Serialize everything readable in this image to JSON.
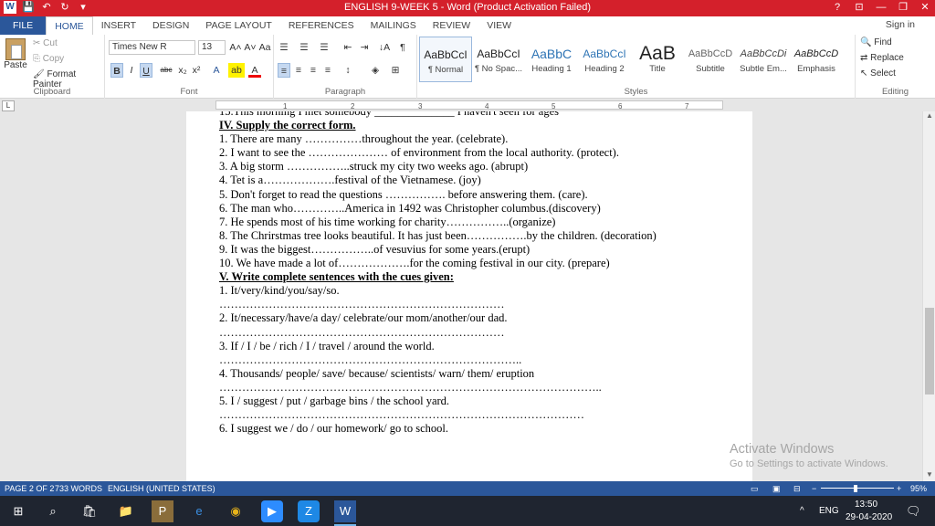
{
  "titlebar": {
    "title": "ENGLISH 9-WEEK 5 -  Word (Product Activation Failed)",
    "help": "?",
    "ribbon_options": "⊡",
    "minimize": "—",
    "restore": "❐",
    "close": "✕"
  },
  "qat": {
    "logo": "W",
    "save": "💾",
    "undo": "↶",
    "redo": "↻",
    "customize": "▾"
  },
  "tabs": [
    "FILE",
    "HOME",
    "INSERT",
    "DESIGN",
    "PAGE LAYOUT",
    "REFERENCES",
    "MAILINGS",
    "REVIEW",
    "VIEW"
  ],
  "signin": "Sign in",
  "clipboard": {
    "paste": "Paste",
    "cut": "Cut",
    "copy": "Copy",
    "format_painter": "Format Painter",
    "label": "Clipboard"
  },
  "font": {
    "name": "Times New R",
    "size": "13",
    "grow": "A˄",
    "shrink": "A˅",
    "case": "Aa",
    "clear": "⌫",
    "bold": "B",
    "italic": "I",
    "underline": "U",
    "strike": "abc",
    "sub": "x₂",
    "sup": "x²",
    "effects": "A",
    "highlight": "ab",
    "color": "A",
    "label": "Font"
  },
  "paragraph": {
    "bullets": "☰",
    "numbering": "☰",
    "multilevel": "☰",
    "dec_indent": "⇤",
    "inc_indent": "⇥",
    "sort": "↓A",
    "pilcrow": "¶",
    "align_left": "≡",
    "center": "≡",
    "align_right": "≡",
    "justify": "≡",
    "spacing": "↕",
    "shading": "◈",
    "borders": "⊞",
    "label": "Paragraph"
  },
  "styles": {
    "items": [
      {
        "preview": "AaBbCcI",
        "name": "¶ Normal"
      },
      {
        "preview": "AaBbCcI",
        "name": "¶ No Spac..."
      },
      {
        "preview": "AaBbC",
        "name": "Heading 1"
      },
      {
        "preview": "AaBbCcI",
        "name": "Heading 2"
      },
      {
        "preview": "AaB",
        "name": "Title"
      },
      {
        "preview": "AaBbCcD",
        "name": "Subtitle"
      },
      {
        "preview": "AaBbCcDi",
        "name": "Subtle Em..."
      },
      {
        "preview": "AaBbCcD",
        "name": "Emphasis"
      }
    ],
    "label": "Styles"
  },
  "editing": {
    "find": "Find",
    "replace": "Replace",
    "select": "Select",
    "label": "Editing"
  },
  "ruler": {
    "corner": "L",
    "numbers": [
      "1",
      "1",
      "2",
      "3",
      "4",
      "5",
      "6",
      "7",
      "8"
    ]
  },
  "document": {
    "lines": [
      "15.This morning I met somebody ______________ I haven't seen for ages",
      "IV. Supply the correct form.",
      "1. There are many ……………throughout the year. (celebrate).",
      "2. I want to see the ………………… of environment from the local authority. (protect).",
      "3. A big storm ……………..struck my city two weeks ago. (abrupt)",
      "4. Tet is a……………….festival of the Vietnamese. (joy)",
      "5. Don't forget to read the questions ……………. before answering them. (care).",
      "6. The man who…………..America in 1492 was Christopher columbus.(discovery)",
      "7. He spends most of his time working for charity……………..(organize)",
      "8. The Chrirstmas tree looks beautiful. It has just been…………….by the children. (decoration)",
      "9. It was the biggest……………..of vesuvius for some years.(erupt)",
      "10. We have made a lot of……………….for the coming festival in our city. (prepare)",
      "V. Write complete sentences with the cues given:",
      "1. It/very/kind/you/say/so.",
      "…………………………………………………………………",
      "2. It/necessary/have/a day/ celebrate/our mom/another/our dad.",
      "…………………………………………………………………",
      "3. If / I / be / rich / I / travel / around the world.",
      "……………………………………………………………………..",
      "4. Thousands/ people/ save/ because/ scientists/ warn/ them/ eruption",
      "………………………………………………………………………………………..",
      "5.  I / suggest / put / garbage bins / the school yard.",
      "……………………………………………………………………………………",
      "6.  I suggest  we / do / our homework/ go to school."
    ]
  },
  "watermark": {
    "line1": "Activate Windows",
    "line2": "Go to Settings to activate Windows."
  },
  "status": {
    "page": "PAGE 2 OF 2",
    "words": "733 WORDS",
    "language": "ENGLISH (UNITED STATES)",
    "zoom": "95%",
    "zoom_minus": "−",
    "zoom_plus": "+"
  },
  "taskbar": {
    "lang": "ENG",
    "time": "13:50",
    "date": "29-04-2020",
    "start": "⊞",
    "search": "⌕",
    "store": "🛍",
    "explorer": "📁",
    "pp": "P",
    "edge": "e",
    "chrome": "◉",
    "zoom_app": "▶",
    "zalo": "Z",
    "word": "W",
    "tray_up": "^",
    "network": "▭",
    "volume": "🔊",
    "notifications": "🗨"
  }
}
